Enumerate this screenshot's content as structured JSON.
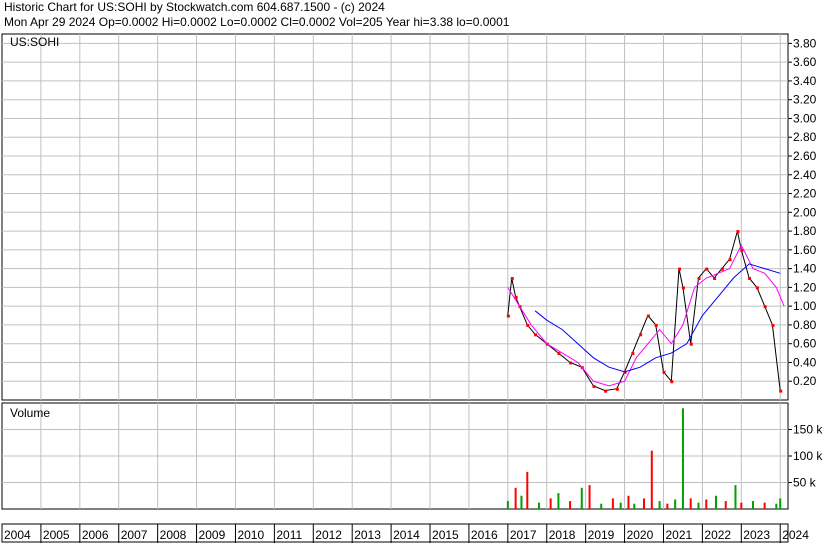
{
  "header": {
    "title": "Historic Chart for US:SOHI by Stockwatch.com 604.687.1500 - (c) 2024",
    "summary": "Mon Apr 29 2024   Op=0.0002  Hi=0.0002  Lo=0.0002  Cl=0.0002  Vol=205   Year hi=3.38   lo=0.0001"
  },
  "colors": {
    "grid": "#c0c0c0",
    "price": "#000000",
    "close": "#ff0000",
    "ma_short": "#ff00ff",
    "ma_long": "#0000ff",
    "volume_up": "#00a000",
    "volume_down": "#ff0000"
  },
  "chart_data": [
    {
      "type": "line",
      "title": "US:SOHI",
      "ylim": [
        0,
        3.9
      ],
      "yticks": [
        "0.20",
        "0.40",
        "0.60",
        "0.80",
        "1.00",
        "1.20",
        "1.40",
        "1.60",
        "1.80",
        "2.00",
        "2.20",
        "2.40",
        "2.60",
        "2.80",
        "3.00",
        "3.20",
        "3.40",
        "3.60",
        "3.80"
      ],
      "ytick_values": [
        0.2,
        0.4,
        0.6,
        0.8,
        1.0,
        1.2,
        1.4,
        1.6,
        1.8,
        2.0,
        2.2,
        2.4,
        2.6,
        2.8,
        3.0,
        3.2,
        3.4,
        3.6,
        3.8
      ],
      "xlabels": [
        "2004",
        "2005",
        "2006",
        "2007",
        "2008",
        "2009",
        "2010",
        "2011",
        "2012",
        "2013",
        "2014",
        "2015",
        "2016",
        "2017",
        "2018",
        "2019",
        "2020",
        "2021",
        "2022",
        "2023",
        "2024"
      ],
      "series": [
        {
          "role": "price",
          "x": [
            2017.0,
            2017.1,
            2017.2,
            2017.3,
            2017.5,
            2017.7,
            2018.0,
            2018.3,
            2018.6,
            2018.9,
            2019.2,
            2019.5,
            2019.8,
            2020.0,
            2020.2,
            2020.4,
            2020.6,
            2020.8,
            2021.0,
            2021.2,
            2021.4,
            2021.5,
            2021.7,
            2021.9,
            2022.1,
            2022.3,
            2022.5,
            2022.7,
            2022.9,
            2023.0,
            2023.2,
            2023.4,
            2023.6,
            2023.8,
            2024.0
          ],
          "values": [
            0.9,
            1.3,
            1.1,
            1.0,
            0.8,
            0.7,
            0.6,
            0.5,
            0.4,
            0.35,
            0.15,
            0.1,
            0.12,
            0.3,
            0.5,
            0.7,
            0.9,
            0.8,
            0.3,
            0.2,
            1.4,
            1.2,
            0.6,
            1.3,
            1.4,
            1.3,
            1.4,
            1.5,
            1.8,
            1.6,
            1.3,
            1.2,
            1.0,
            0.8,
            0.1
          ]
        },
        {
          "role": "ma_short",
          "x": [
            2017.0,
            2017.3,
            2017.6,
            2018.0,
            2018.4,
            2018.8,
            2019.2,
            2019.6,
            2020.0,
            2020.3,
            2020.6,
            2020.9,
            2021.2,
            2021.5,
            2021.8,
            2022.1,
            2022.4,
            2022.7,
            2023.0,
            2023.3,
            2023.6,
            2023.9,
            2024.1
          ],
          "values": [
            1.2,
            1.0,
            0.8,
            0.6,
            0.5,
            0.4,
            0.2,
            0.15,
            0.2,
            0.45,
            0.6,
            0.75,
            0.6,
            0.8,
            1.2,
            1.3,
            1.35,
            1.4,
            1.65,
            1.4,
            1.35,
            1.2,
            1.0
          ]
        },
        {
          "role": "ma_long",
          "x": [
            2017.7,
            2018.0,
            2018.4,
            2018.8,
            2019.2,
            2019.6,
            2020.0,
            2020.4,
            2020.8,
            2021.2,
            2021.6,
            2022.0,
            2022.4,
            2022.8,
            2023.2,
            2023.6,
            2024.0
          ],
          "values": [
            0.95,
            0.85,
            0.75,
            0.6,
            0.45,
            0.35,
            0.3,
            0.35,
            0.45,
            0.5,
            0.6,
            0.9,
            1.1,
            1.3,
            1.45,
            1.4,
            1.35
          ]
        }
      ]
    },
    {
      "type": "bar",
      "title": "Volume",
      "ylim": [
        0,
        200000
      ],
      "yticks": [
        "50 k",
        "100 k",
        "150 k"
      ],
      "ytick_values": [
        50000,
        100000,
        150000
      ],
      "x": [
        2017.0,
        2017.2,
        2017.35,
        2017.5,
        2017.8,
        2018.1,
        2018.3,
        2018.6,
        2018.9,
        2019.1,
        2019.4,
        2019.7,
        2019.9,
        2020.1,
        2020.25,
        2020.5,
        2020.7,
        2020.9,
        2021.1,
        2021.3,
        2021.5,
        2021.7,
        2021.9,
        2022.1,
        2022.35,
        2022.6,
        2022.85,
        2023.0,
        2023.3,
        2023.6,
        2023.9,
        2024.0
      ],
      "values": [
        15000,
        40000,
        25000,
        70000,
        12000,
        20000,
        30000,
        15000,
        40000,
        45000,
        10000,
        20000,
        12000,
        25000,
        10000,
        20000,
        110000,
        15000,
        10000,
        18000,
        190000,
        20000,
        12000,
        18000,
        25000,
        15000,
        45000,
        12000,
        15000,
        12000,
        10000,
        20000
      ],
      "up": [
        true,
        false,
        true,
        false,
        true,
        false,
        true,
        false,
        true,
        false,
        true,
        false,
        true,
        false,
        true,
        false,
        false,
        true,
        false,
        true,
        true,
        false,
        true,
        false,
        true,
        false,
        true,
        false,
        true,
        false,
        true,
        true
      ]
    }
  ]
}
